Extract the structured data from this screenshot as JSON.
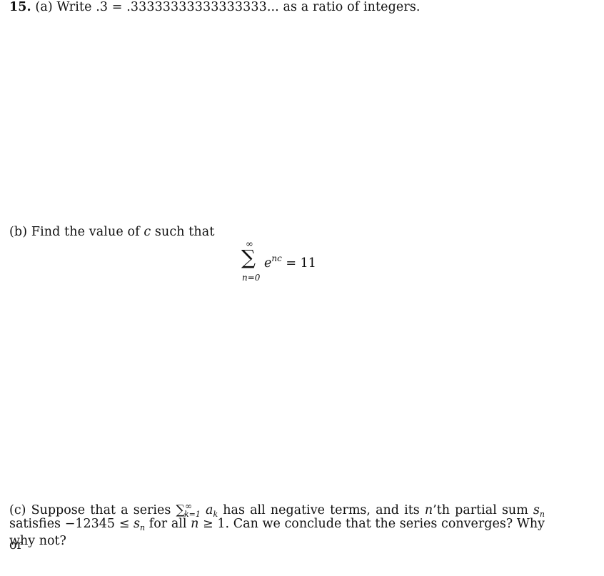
{
  "problem": {
    "number": "15.",
    "part_a": {
      "label": "(a)",
      "text_before": "Write .",
      "repeating_digit": "3",
      "equals": " = .33333333333333333... as a ratio of integers."
    },
    "part_b": {
      "label": "(b)",
      "text_before": "Find the value of ",
      "variable": "c",
      "text_after": " such that",
      "equation": {
        "upper_limit": "∞",
        "sigma": "∑",
        "lower_limit": "n=0",
        "base": "e",
        "exponent": "nc",
        "rhs": " = 11"
      }
    },
    "part_c": {
      "label": "(c)",
      "line1_a": " Suppose that a series ",
      "sum_sym": "∑",
      "sum_sup": "∞",
      "sum_sub": "k=1",
      "term_base": "a",
      "term_sub": "k",
      "line1_b": " has all negative terms, and its ",
      "n_var": "n",
      "line1_c": "’th partial sum ",
      "s_var": "s",
      "s_sub": "n",
      "line2_a": "satisfies −12345 ≤ ",
      "line2_b": " for all ",
      "line2_c": " ≥ 1. Can we conclude that the series converges? Why or",
      "line3": "why not?"
    }
  }
}
